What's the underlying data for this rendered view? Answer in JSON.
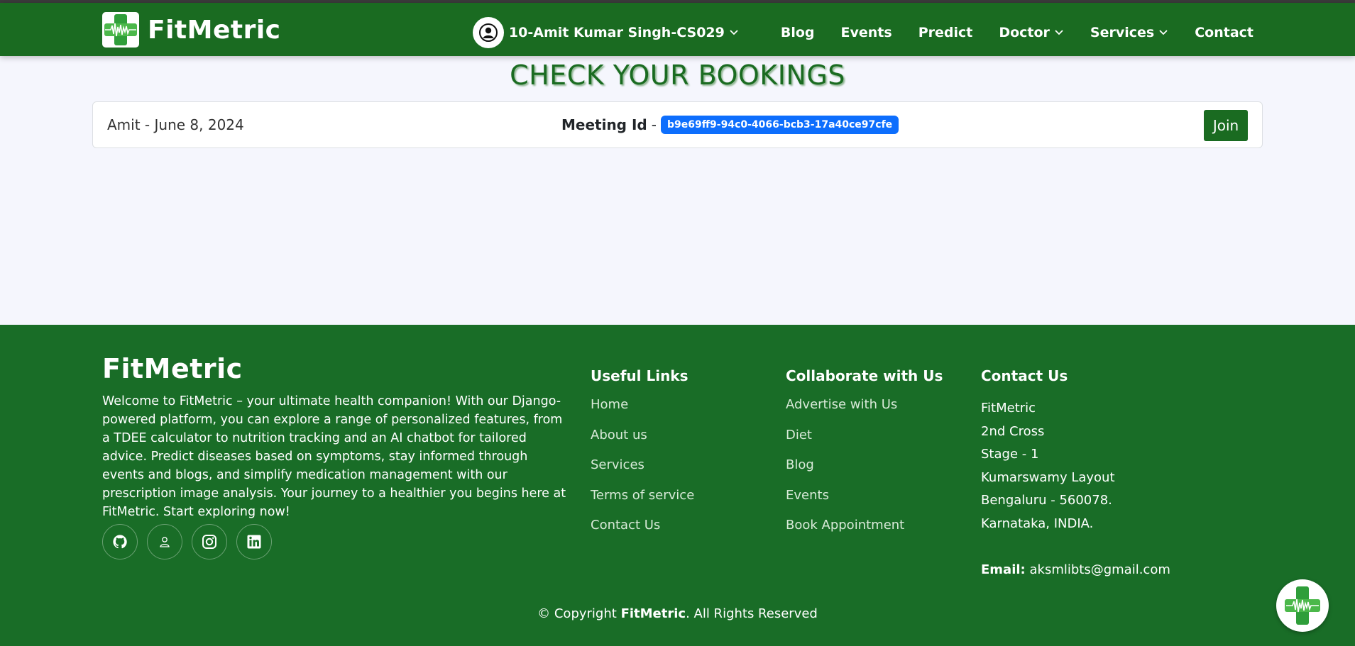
{
  "header": {
    "brand": "FitMetric",
    "user_name": "10-Amit Kumar Singh-CS029",
    "nav": [
      "Blog",
      "Events",
      "Predict",
      "Doctor",
      "Services",
      "Contact"
    ]
  },
  "main": {
    "title": "CHECK YOUR BOOKINGS",
    "booking": {
      "name_date": "Amit - June 8, 2024",
      "meeting_label": "Meeting Id",
      "separator": "-",
      "meeting_id": "b9e69ff9-94c0-4066-bcb3-17a40ce97cfe",
      "join_label": "Join"
    }
  },
  "footer": {
    "brand": "FitMetric",
    "about": "Welcome to FitMetric – your ultimate health companion! With our Django-powered platform, you can explore a range of personalized features, from a TDEE calculator to nutrition tracking and an AI chatbot for tailored advice. Predict diseases based on symptoms, stay informed through events and blogs, and simplify medication management with our prescription image analysis. Your journey to a healthier you begins here at FitMetric. Start exploring now!",
    "useful_links": {
      "title": "Useful Links",
      "items": [
        "Home",
        "About us",
        "Services",
        "Terms of service",
        "Contact Us"
      ]
    },
    "collaborate": {
      "title": "Collaborate with Us",
      "items": [
        "Advertise with Us",
        "Diet",
        "Blog",
        "Events",
        "Book Appointment"
      ]
    },
    "contact": {
      "title": "Contact Us",
      "lines": [
        "FitMetric",
        "2nd Cross",
        "Stage - 1",
        "Kumarswamy Layout",
        "Bengaluru - 560078.",
        "Karnataka, INDIA."
      ],
      "email_label": "Email:",
      "email": "aksmlibts@gmail.com"
    },
    "copyright_prefix": "© Copyright",
    "copyright_brand": "FitMetric",
    "copyright_suffix": ". All Rights Reserved",
    "social_icons": [
      "github-icon",
      "person-icon",
      "instagram-icon",
      "linkedin-icon"
    ]
  },
  "colors": {
    "brand_green": "#1a6b21",
    "footer_green": "#196d27",
    "badge_blue": "#0d6efd",
    "page_bg": "#f5f6fd"
  }
}
